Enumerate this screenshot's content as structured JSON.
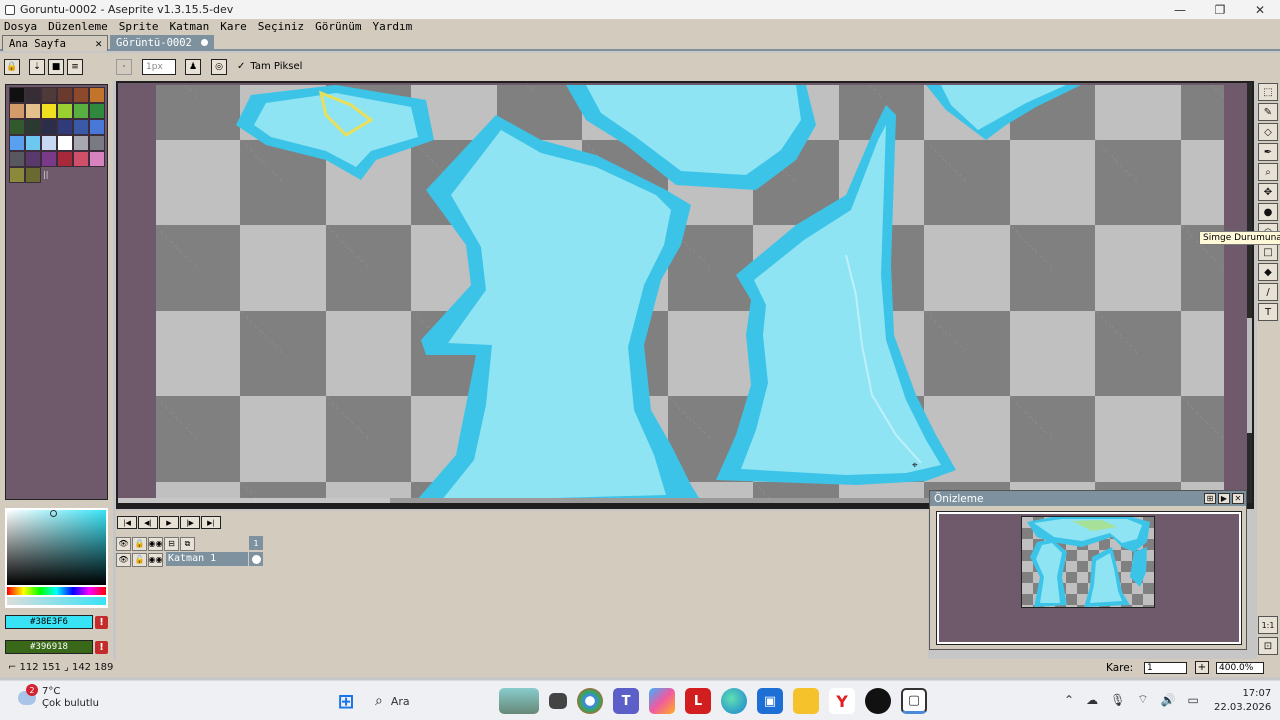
{
  "window": {
    "title": "Goruntu-0002 - Aseprite v1.3.15.5-dev",
    "controls": [
      "—",
      "❐",
      "✕"
    ]
  },
  "menu": [
    "Dosya",
    "Düzenleme",
    "Sprite",
    "Katman",
    "Kare",
    "Seçiniz",
    "Görünüm",
    "Yardım"
  ],
  "tabs": {
    "home": "Ana Sayfa",
    "home_close": "✕",
    "document": "Görüntü-0002"
  },
  "context_bar": {
    "brush_size": "1px",
    "pixel_perfect_label": "Tam Piksel",
    "pixel_perfect_checked": "✓"
  },
  "palette": {
    "colors": [
      "#101010",
      "#372d35",
      "#4f3a3a",
      "#6b3a2f",
      "#8c4a2a",
      "#c2742b",
      "#d39a6a",
      "#e6c08a",
      "#f0e020",
      "#9ad030",
      "#58b040",
      "#2f8a3e",
      "#335a2c",
      "#2a3a30",
      "#2a2e48",
      "#303c7a",
      "#3a5aa8",
      "#4a78d8",
      "#5aa0f0",
      "#6cc8f0",
      "#c6d8f2",
      "#ffffff",
      "#a8a8b0",
      "#7a7a84",
      "#585860",
      "#5a3a6a",
      "#7a3a8a",
      "#a82a3a",
      "#d0506a",
      "#d882c0",
      "#8a8a3a",
      "#6a6a30"
    ],
    "marker": "||"
  },
  "colors": {
    "foreground_hex": "#38e3f6",
    "background_hex": "#396918",
    "foreground_label": "#38E3F6",
    "background_label": "#396918",
    "warn_mark": "!"
  },
  "tooltip": "Simge Durumuna",
  "tools": [
    "⬚",
    "✎",
    "◇",
    "✒",
    "⌕",
    "✥",
    "●",
    "◠",
    "□",
    "◆",
    "/",
    "T"
  ],
  "timeline": {
    "buttons": [
      "|◀",
      "◀|",
      "▶",
      "|▶",
      "▶|"
    ],
    "frame_number": "1",
    "layer_name": "Katman 1",
    "header_icons": [
      "👁",
      "🔒",
      "◉◉",
      "⊟",
      "⧉"
    ],
    "layer_icons": [
      "👁",
      "🔓",
      "◉◉"
    ]
  },
  "preview": {
    "title": "Önizleme",
    "buttons": [
      "⊞",
      "▶",
      "✕"
    ]
  },
  "side_buttons": [
    "1:1",
    "⊡"
  ],
  "status": {
    "position": "⌐ 112 151  ⌟ 142 189",
    "frame_label": "Kare:",
    "frame_value": "1",
    "frame_plus": "+",
    "zoom": "400.0%"
  },
  "taskbar": {
    "weather_temp": "7°C",
    "weather_desc": "Çok bulutlu",
    "weather_badge": "2",
    "search_placeholder": "Ara",
    "time": "17:07",
    "date": "22.03.2026"
  }
}
